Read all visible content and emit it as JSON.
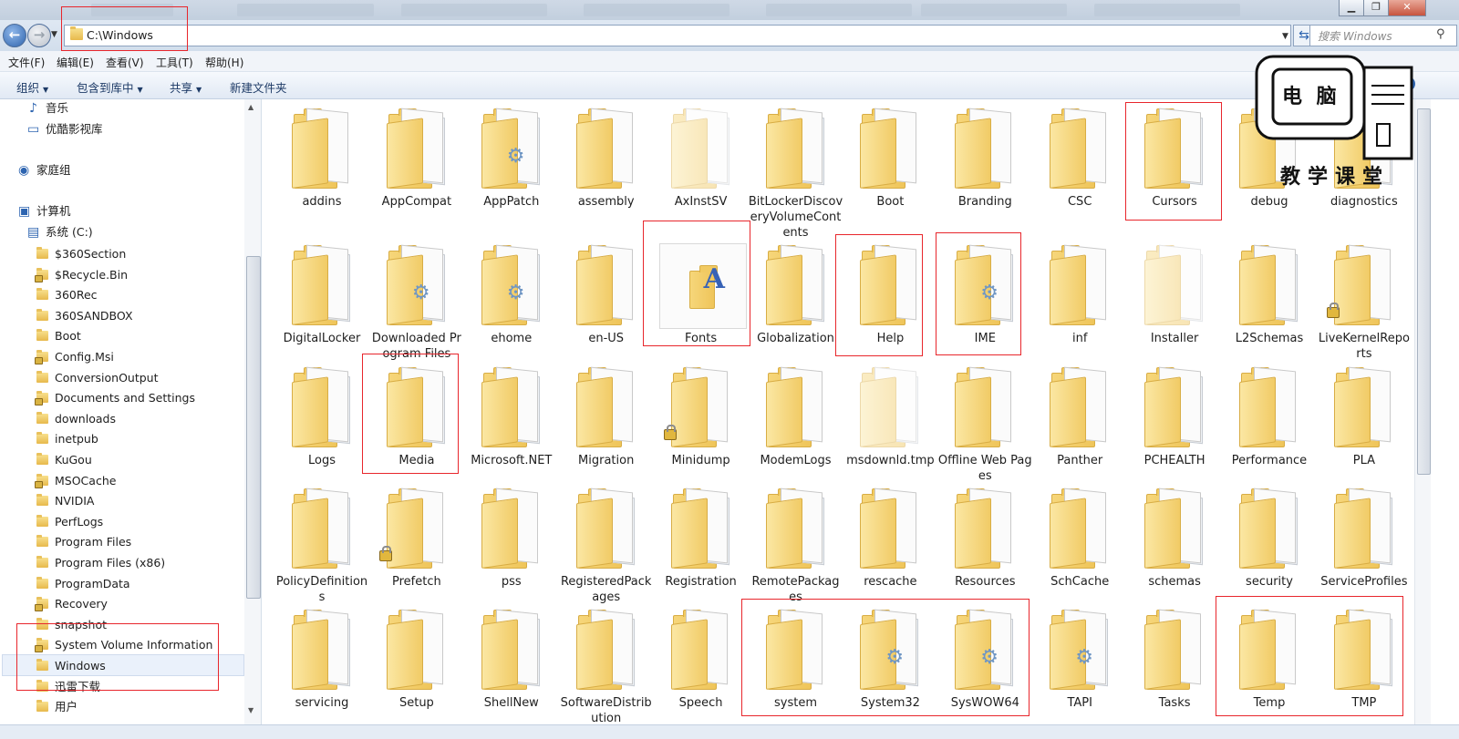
{
  "window": {
    "minimize": "▁",
    "maximize": "❐",
    "close": "✕"
  },
  "address": {
    "path": "C:\\Windows",
    "search_placeholder": "搜索 Windows"
  },
  "menu": [
    "文件(F)",
    "编辑(E)",
    "查看(V)",
    "工具(T)",
    "帮助(H)"
  ],
  "toolbar": {
    "organize": "组织",
    "include": "包含到库中",
    "share": "共享",
    "new_folder": "新建文件夹"
  },
  "nav": {
    "top": [
      {
        "label": "音乐",
        "icon": "music-icon"
      },
      {
        "label": "优酷影视库",
        "icon": "library-icon"
      },
      {
        "label": "家庭组",
        "icon": "homegroup-icon"
      },
      {
        "label": "计算机",
        "icon": "computer-icon"
      },
      {
        "label": "系统 (C:)",
        "icon": "drive-icon"
      }
    ],
    "folders": [
      "$360Section",
      "$Recycle.Bin",
      "360Rec",
      "360SANDBOX",
      "Boot",
      "Config.Msi",
      "ConversionOutput",
      "Documents and Settings",
      "downloads",
      "inetpub",
      "KuGou",
      "MSOCache",
      "NVIDIA",
      "PerfLogs",
      "Program Files",
      "Program Files (x86)",
      "ProgramData",
      "Recovery",
      "snapshot",
      "System Volume Information",
      "Windows",
      "迅雷下载",
      "用户"
    ],
    "selected": "Windows"
  },
  "folders": [
    [
      "addins",
      "AppCompat",
      "AppPatch",
      "assembly",
      "AxInstSV",
      "BitLockerDiscoveryVolumeContents",
      "Boot",
      "Branding",
      "CSC",
      "Cursors",
      "debug",
      "diagnostics"
    ],
    [
      "DigitalLocker",
      "Downloaded Program Files",
      "ehome",
      "en-US",
      "Fonts",
      "Globalization",
      "Help",
      "IME",
      "inf",
      "Installer",
      "L2Schemas",
      "LiveKernelReports"
    ],
    [
      "Logs",
      "Media",
      "Microsoft.NET",
      "Migration",
      "Minidump",
      "ModemLogs",
      "msdownld.tmp",
      "Offline Web Pages",
      "Panther",
      "PCHEALTH",
      "Performance",
      "PLA"
    ],
    [
      "PolicyDefinitions",
      "Prefetch",
      "pss",
      "RegisteredPackages",
      "Registration",
      "RemotePackages",
      "rescache",
      "Resources",
      "SchCache",
      "schemas",
      "security",
      "ServiceProfiles"
    ],
    [
      "servicing",
      "Setup",
      "ShellNew",
      "SoftwareDistribution",
      "Speech",
      "system",
      "System32",
      "SysWOW64",
      "TAPI",
      "Tasks",
      "Temp",
      "TMP"
    ]
  ],
  "watermark": {
    "title": "电 脑",
    "subtitle": "教学课堂"
  }
}
